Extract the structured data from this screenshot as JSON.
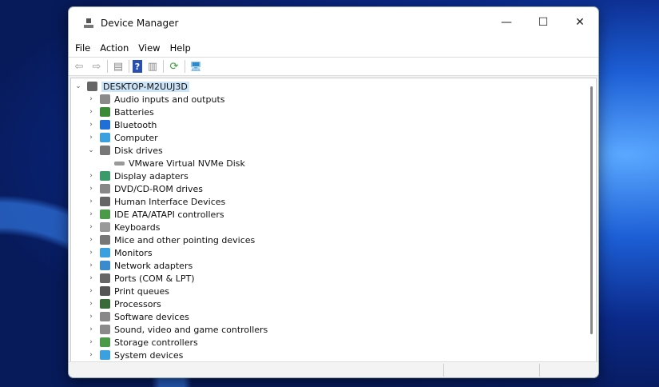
{
  "window": {
    "title": "Device Manager",
    "minimize": "—",
    "maximize": "☐",
    "close": "✕"
  },
  "menu": [
    "File",
    "Action",
    "View",
    "Help"
  ],
  "toolbar": [
    {
      "icon": "back-arrow-icon",
      "glyph": "⇦"
    },
    {
      "icon": "forward-arrow-icon",
      "glyph": "⇨"
    },
    {
      "icon": "properties-icon",
      "glyph": "▤"
    },
    {
      "icon": "help-icon",
      "glyph": "?"
    },
    {
      "icon": "view-icon",
      "glyph": "▥"
    },
    {
      "icon": "update-driver-icon",
      "glyph": "⟳"
    },
    {
      "icon": "scan-hardware-icon",
      "glyph": "🖥"
    }
  ],
  "tree": {
    "root": "DESKTOP-M2UUJ3D",
    "items": [
      {
        "label": "Audio inputs and outputs",
        "color": "#8a8a8a"
      },
      {
        "label": "Batteries",
        "color": "#3a8a3a"
      },
      {
        "label": "Bluetooth",
        "color": "#1f6fd6"
      },
      {
        "label": "Computer",
        "color": "#3aa0e0"
      },
      {
        "label": "Disk drives",
        "color": "#777",
        "expanded": true,
        "children": [
          "VMware Virtual NVMe Disk"
        ]
      },
      {
        "label": "Display adapters",
        "color": "#3a9a6a"
      },
      {
        "label": "DVD/CD-ROM drives",
        "color": "#888"
      },
      {
        "label": "Human Interface Devices",
        "color": "#666"
      },
      {
        "label": "IDE ATA/ATAPI controllers",
        "color": "#4a9a4a"
      },
      {
        "label": "Keyboards",
        "color": "#999"
      },
      {
        "label": "Mice and other pointing devices",
        "color": "#777"
      },
      {
        "label": "Monitors",
        "color": "#3aa0e0"
      },
      {
        "label": "Network adapters",
        "color": "#3a8ad0"
      },
      {
        "label": "Ports (COM & LPT)",
        "color": "#666"
      },
      {
        "label": "Print queues",
        "color": "#555"
      },
      {
        "label": "Processors",
        "color": "#3a6a3a"
      },
      {
        "label": "Software devices",
        "color": "#888"
      },
      {
        "label": "Sound, video and game controllers",
        "color": "#8a8a8a"
      },
      {
        "label": "Storage controllers",
        "color": "#4a9a4a"
      },
      {
        "label": "System devices",
        "color": "#3aa0e0"
      }
    ]
  }
}
